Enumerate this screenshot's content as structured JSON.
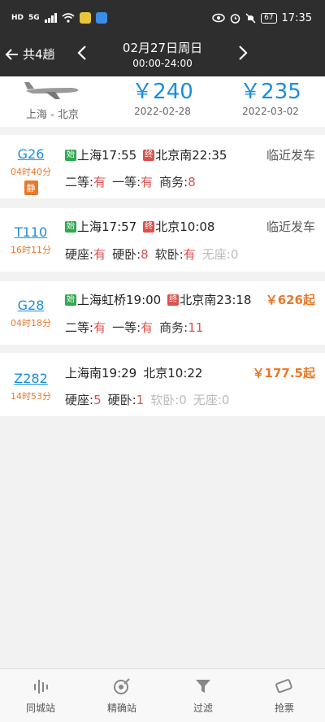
{
  "status_bar": {
    "network": "HD",
    "signal_type": "5G",
    "battery": "67",
    "time": "17:35",
    "app_colors": [
      "#e8c53a",
      "#3a8ee8"
    ]
  },
  "header": {
    "back_label": "共4趟",
    "date": "02月27日周日",
    "time_range": "00:00-24:00"
  },
  "price_panel": {
    "route": "上海 - 北京",
    "prices": [
      {
        "price": "￥240",
        "date": "2022-02-28"
      },
      {
        "price": "￥235",
        "date": "2022-03-02"
      }
    ]
  },
  "trains": [
    {
      "code": "G26",
      "duration": "04时40分",
      "tag": "静",
      "from_badge": "始",
      "from": "上海17:55",
      "to_badge": "终",
      "to": "北京南22:35",
      "state": "临近发车",
      "seats": [
        {
          "name": "二等:",
          "value": "有"
        },
        {
          "name": "一等:",
          "value": "有"
        },
        {
          "name": "商务:",
          "value": "8"
        }
      ]
    },
    {
      "code": "T110",
      "duration": "16时11分",
      "from_badge": "始",
      "from": "上海17:57",
      "to_badge": "终",
      "to": "北京10:08",
      "state": "临近发车",
      "seats": [
        {
          "name": "硬座:",
          "value": "有"
        },
        {
          "name": "硬卧:",
          "value": "8"
        },
        {
          "name": "软卧:",
          "value": "有"
        },
        {
          "name": "无座:",
          "value": "0",
          "muted": true
        }
      ]
    },
    {
      "code": "G28",
      "duration": "04时18分",
      "from_badge": "始",
      "from": "上海虹桥19:00",
      "to_badge": "终",
      "to": "北京南23:18",
      "state": "￥626起",
      "seats": [
        {
          "name": "二等:",
          "value": "有"
        },
        {
          "name": "一等:",
          "value": "有"
        },
        {
          "name": "商务:",
          "value": "11"
        }
      ]
    },
    {
      "code": "Z282",
      "duration": "14时53分",
      "from": "上海南19:29",
      "to": "北京10:22",
      "state": "￥177.5起",
      "seats": [
        {
          "name": "硬座:",
          "value": "5"
        },
        {
          "name": "硬卧:",
          "value": "1"
        },
        {
          "name": "软卧:",
          "value": "0",
          "muted": true
        },
        {
          "name": "无座:",
          "value": "0",
          "muted": true
        }
      ]
    }
  ],
  "bottom_nav": [
    {
      "label": "同城站",
      "icon": "same-city-icon"
    },
    {
      "label": "精确站",
      "icon": "target-icon"
    },
    {
      "label": "过滤",
      "icon": "filter-icon"
    },
    {
      "label": "抢票",
      "icon": "ticket-icon"
    }
  ]
}
